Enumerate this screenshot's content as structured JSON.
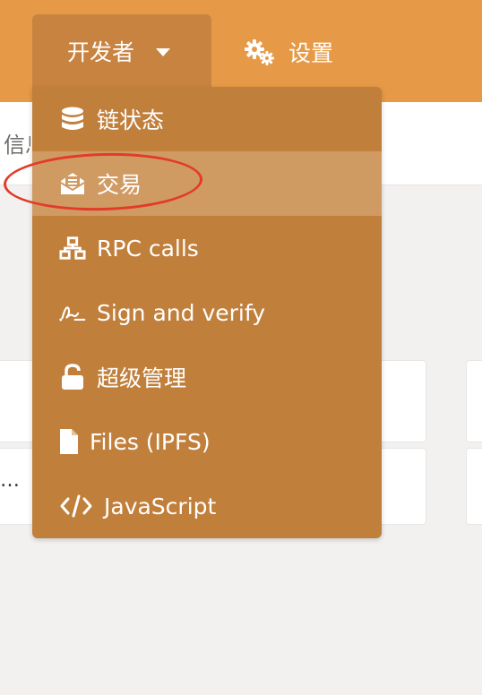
{
  "nav": {
    "developer_label": "开发者",
    "settings_label": "设置"
  },
  "page": {
    "partial_title": "信息"
  },
  "cards": {
    "truncated_text": "…"
  },
  "menu": {
    "items": [
      {
        "label": "链状态",
        "icon": "database-icon"
      },
      {
        "label": "交易",
        "icon": "envelope-open-icon",
        "highlighted": true
      },
      {
        "label": "RPC calls",
        "icon": "network-icon"
      },
      {
        "label": "Sign and verify",
        "icon": "signature-icon"
      },
      {
        "label": "超级管理",
        "icon": "unlock-icon"
      },
      {
        "label": "Files (IPFS)",
        "icon": "file-icon"
      },
      {
        "label": "JavaScript",
        "icon": "code-icon"
      }
    ]
  },
  "annotation": {
    "ring_color": "#e23b2a"
  },
  "colors": {
    "topbar": "#e69a47",
    "menu": "#c17f3c",
    "menu_highlight": "#d09a63"
  }
}
